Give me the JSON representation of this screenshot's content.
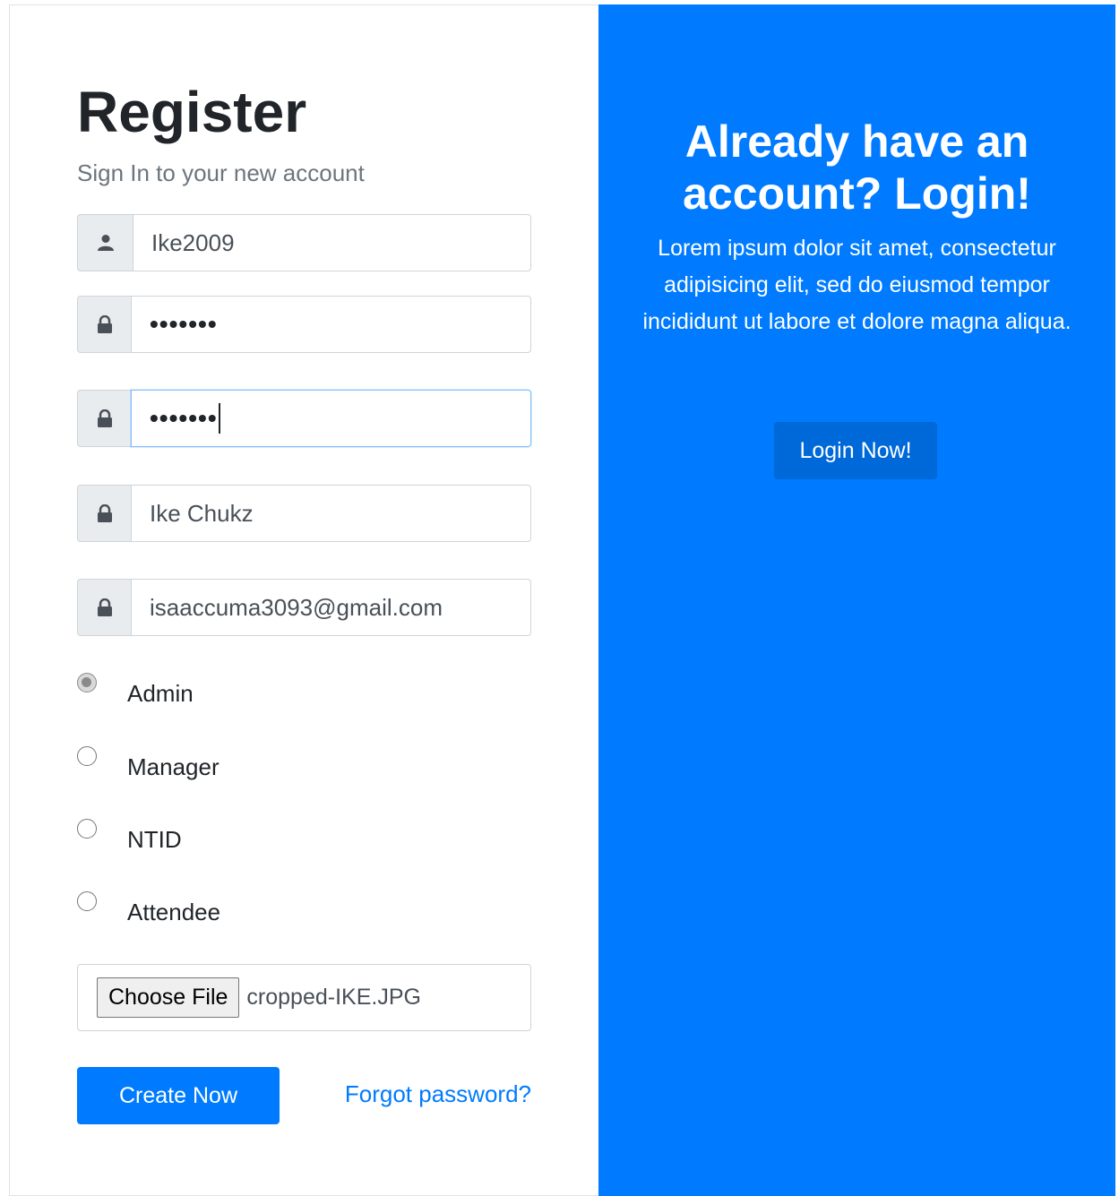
{
  "register": {
    "title": "Register",
    "subtitle": "Sign In to your new account",
    "fields": [
      {
        "icon": "user-icon",
        "value": "Ike2009"
      },
      {
        "icon": "lock-icon",
        "value": "•••••••"
      },
      {
        "icon": "lock-icon",
        "value": "•••••••"
      },
      {
        "icon": "lock-icon",
        "value": "Ike Chukz"
      },
      {
        "icon": "lock-icon",
        "value": "isaaccuma3093@gmail.com"
      }
    ],
    "roles": [
      {
        "label": "Admin",
        "checked": true
      },
      {
        "label": "Manager",
        "checked": false
      },
      {
        "label": "NTID",
        "checked": false
      },
      {
        "label": "Attendee",
        "checked": false
      }
    ],
    "file": {
      "button_label": "Choose File",
      "file_name": "cropped-IKE.JPG"
    },
    "create_button": "Create Now",
    "forgot_link": "Forgot password?"
  },
  "login_panel": {
    "title": "Already have an account? Login!",
    "text": "Lorem ipsum dolor sit amet, consectetur adipisicing elit, sed do eiusmod tempor incididunt ut labore et dolore magna aliqua.",
    "button": "Login Now!"
  },
  "colors": {
    "primary": "#007bff",
    "primary_dark": "#0069d9",
    "addon_bg": "#e9ecef"
  }
}
